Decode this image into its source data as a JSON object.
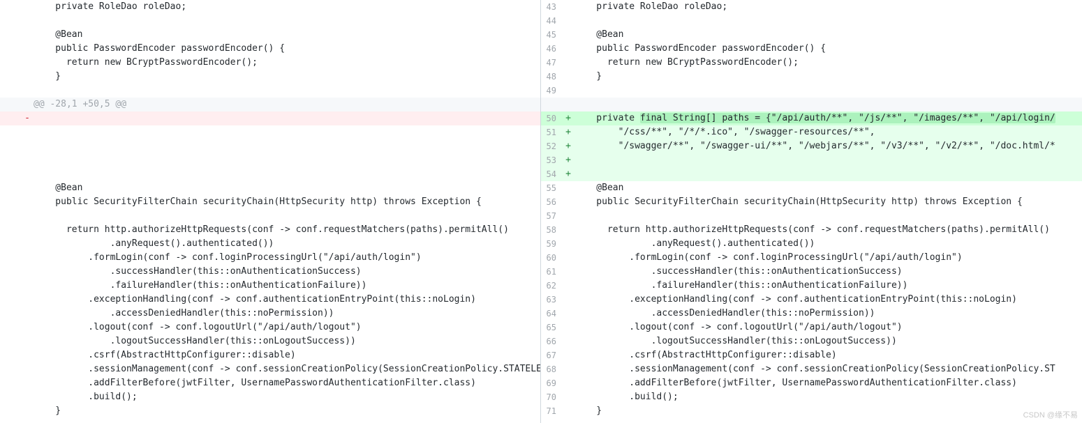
{
  "watermark": "CSDN @缘不易",
  "left": {
    "rows": [
      {
        "ln": "",
        "cls": "",
        "sign": "",
        "text": "    private RoleDao roleDao;"
      },
      {
        "ln": "",
        "cls": "",
        "sign": "",
        "text": ""
      },
      {
        "ln": "",
        "cls": "",
        "sign": "",
        "text": "    @Bean"
      },
      {
        "ln": "",
        "cls": "",
        "sign": "",
        "text": "    public PasswordEncoder passwordEncoder() {"
      },
      {
        "ln": "",
        "cls": "",
        "sign": "",
        "text": "      return new BCryptPasswordEncoder();"
      },
      {
        "ln": "",
        "cls": "",
        "sign": "",
        "text": "    }"
      },
      {
        "ln": "",
        "cls": "",
        "sign": "",
        "text": ""
      },
      {
        "ln": "",
        "cls": "hunk",
        "sign": "",
        "text": "@@ -28,1 +50,5 @@"
      },
      {
        "ln": "",
        "cls": "del",
        "sign": "-",
        "text": ""
      },
      {
        "ln": "",
        "cls": "",
        "sign": "",
        "text": ""
      },
      {
        "ln": "",
        "cls": "",
        "sign": "",
        "text": ""
      },
      {
        "ln": "",
        "cls": "",
        "sign": "",
        "text": ""
      },
      {
        "ln": "",
        "cls": "",
        "sign": "",
        "text": ""
      },
      {
        "ln": "",
        "cls": "",
        "sign": "",
        "text": "    @Bean"
      },
      {
        "ln": "",
        "cls": "",
        "sign": "",
        "text": "    public SecurityFilterChain securityChain(HttpSecurity http) throws Exception {"
      },
      {
        "ln": "",
        "cls": "",
        "sign": "",
        "text": ""
      },
      {
        "ln": "",
        "cls": "",
        "sign": "",
        "text": "      return http.authorizeHttpRequests(conf -> conf.requestMatchers(paths).permitAll()"
      },
      {
        "ln": "",
        "cls": "",
        "sign": "",
        "text": "              .anyRequest().authenticated())"
      },
      {
        "ln": "",
        "cls": "",
        "sign": "",
        "text": "          .formLogin(conf -> conf.loginProcessingUrl(\"/api/auth/login\")"
      },
      {
        "ln": "",
        "cls": "",
        "sign": "",
        "text": "              .successHandler(this::onAuthenticationSuccess)"
      },
      {
        "ln": "",
        "cls": "",
        "sign": "",
        "text": "              .failureHandler(this::onAuthenticationFailure))"
      },
      {
        "ln": "",
        "cls": "",
        "sign": "",
        "text": "          .exceptionHandling(conf -> conf.authenticationEntryPoint(this::noLogin)"
      },
      {
        "ln": "",
        "cls": "",
        "sign": "",
        "text": "              .accessDeniedHandler(this::noPermission))"
      },
      {
        "ln": "",
        "cls": "",
        "sign": "",
        "text": "          .logout(conf -> conf.logoutUrl(\"/api/auth/logout\")"
      },
      {
        "ln": "",
        "cls": "",
        "sign": "",
        "text": "              .logoutSuccessHandler(this::onLogoutSuccess))"
      },
      {
        "ln": "",
        "cls": "",
        "sign": "",
        "text": "          .csrf(AbstractHttpConfigurer::disable)"
      },
      {
        "ln": "",
        "cls": "",
        "sign": "",
        "text": "          .sessionManagement(conf -> conf.sessionCreationPolicy(SessionCreationPolicy.STATELESS"
      },
      {
        "ln": "",
        "cls": "",
        "sign": "",
        "text": "          .addFilterBefore(jwtFilter, UsernamePasswordAuthenticationFilter.class)"
      },
      {
        "ln": "",
        "cls": "",
        "sign": "",
        "text": "          .build();"
      },
      {
        "ln": "",
        "cls": "",
        "sign": "",
        "text": "    }"
      }
    ]
  },
  "right": {
    "rows": [
      {
        "ln": "43",
        "cls": "",
        "sign": "",
        "text": "    private RoleDao roleDao;"
      },
      {
        "ln": "44",
        "cls": "",
        "sign": "",
        "text": ""
      },
      {
        "ln": "45",
        "cls": "",
        "sign": "",
        "text": "    @Bean"
      },
      {
        "ln": "46",
        "cls": "",
        "sign": "",
        "text": "    public PasswordEncoder passwordEncoder() {"
      },
      {
        "ln": "47",
        "cls": "",
        "sign": "",
        "text": "      return new BCryptPasswordEncoder();"
      },
      {
        "ln": "48",
        "cls": "",
        "sign": "",
        "text": "    }"
      },
      {
        "ln": "49",
        "cls": "",
        "sign": "",
        "text": ""
      },
      {
        "ln": "",
        "cls": "hunk",
        "sign": "",
        "text": " "
      },
      {
        "ln": "50",
        "cls": "add strong",
        "sign": "+",
        "pre": "    private ",
        "hl": "final String[] paths = {\"/api/auth/**\", \"/js/**\", \"/images/**\", \"/api/login/"
      },
      {
        "ln": "51",
        "cls": "add",
        "sign": "+",
        "text": "        \"/css/**\", \"/*/*.ico\", \"/swagger-resources/**\","
      },
      {
        "ln": "52",
        "cls": "add",
        "sign": "+",
        "text": "        \"/swagger/**\", \"/swagger-ui/**\", \"/webjars/**\", \"/v3/**\", \"/v2/**\", \"/doc.html/*"
      },
      {
        "ln": "53",
        "cls": "add",
        "sign": "+",
        "text": ""
      },
      {
        "ln": "54",
        "cls": "add",
        "sign": "+",
        "text": ""
      },
      {
        "ln": "55",
        "cls": "",
        "sign": "",
        "text": "    @Bean"
      },
      {
        "ln": "56",
        "cls": "",
        "sign": "",
        "text": "    public SecurityFilterChain securityChain(HttpSecurity http) throws Exception {"
      },
      {
        "ln": "57",
        "cls": "",
        "sign": "",
        "text": ""
      },
      {
        "ln": "58",
        "cls": "",
        "sign": "",
        "text": "      return http.authorizeHttpRequests(conf -> conf.requestMatchers(paths).permitAll()"
      },
      {
        "ln": "59",
        "cls": "",
        "sign": "",
        "text": "              .anyRequest().authenticated())"
      },
      {
        "ln": "60",
        "cls": "",
        "sign": "",
        "text": "          .formLogin(conf -> conf.loginProcessingUrl(\"/api/auth/login\")"
      },
      {
        "ln": "61",
        "cls": "",
        "sign": "",
        "text": "              .successHandler(this::onAuthenticationSuccess)"
      },
      {
        "ln": "62",
        "cls": "",
        "sign": "",
        "text": "              .failureHandler(this::onAuthenticationFailure))"
      },
      {
        "ln": "63",
        "cls": "",
        "sign": "",
        "text": "          .exceptionHandling(conf -> conf.authenticationEntryPoint(this::noLogin)"
      },
      {
        "ln": "64",
        "cls": "",
        "sign": "",
        "text": "              .accessDeniedHandler(this::noPermission))"
      },
      {
        "ln": "65",
        "cls": "",
        "sign": "",
        "text": "          .logout(conf -> conf.logoutUrl(\"/api/auth/logout\")"
      },
      {
        "ln": "66",
        "cls": "",
        "sign": "",
        "text": "              .logoutSuccessHandler(this::onLogoutSuccess))"
      },
      {
        "ln": "67",
        "cls": "",
        "sign": "",
        "text": "          .csrf(AbstractHttpConfigurer::disable)"
      },
      {
        "ln": "68",
        "cls": "",
        "sign": "",
        "text": "          .sessionManagement(conf -> conf.sessionCreationPolicy(SessionCreationPolicy.ST"
      },
      {
        "ln": "69",
        "cls": "",
        "sign": "",
        "text": "          .addFilterBefore(jwtFilter, UsernamePasswordAuthenticationFilter.class)"
      },
      {
        "ln": "70",
        "cls": "",
        "sign": "",
        "text": "          .build();"
      },
      {
        "ln": "71",
        "cls": "",
        "sign": "",
        "text": "    }"
      }
    ]
  }
}
